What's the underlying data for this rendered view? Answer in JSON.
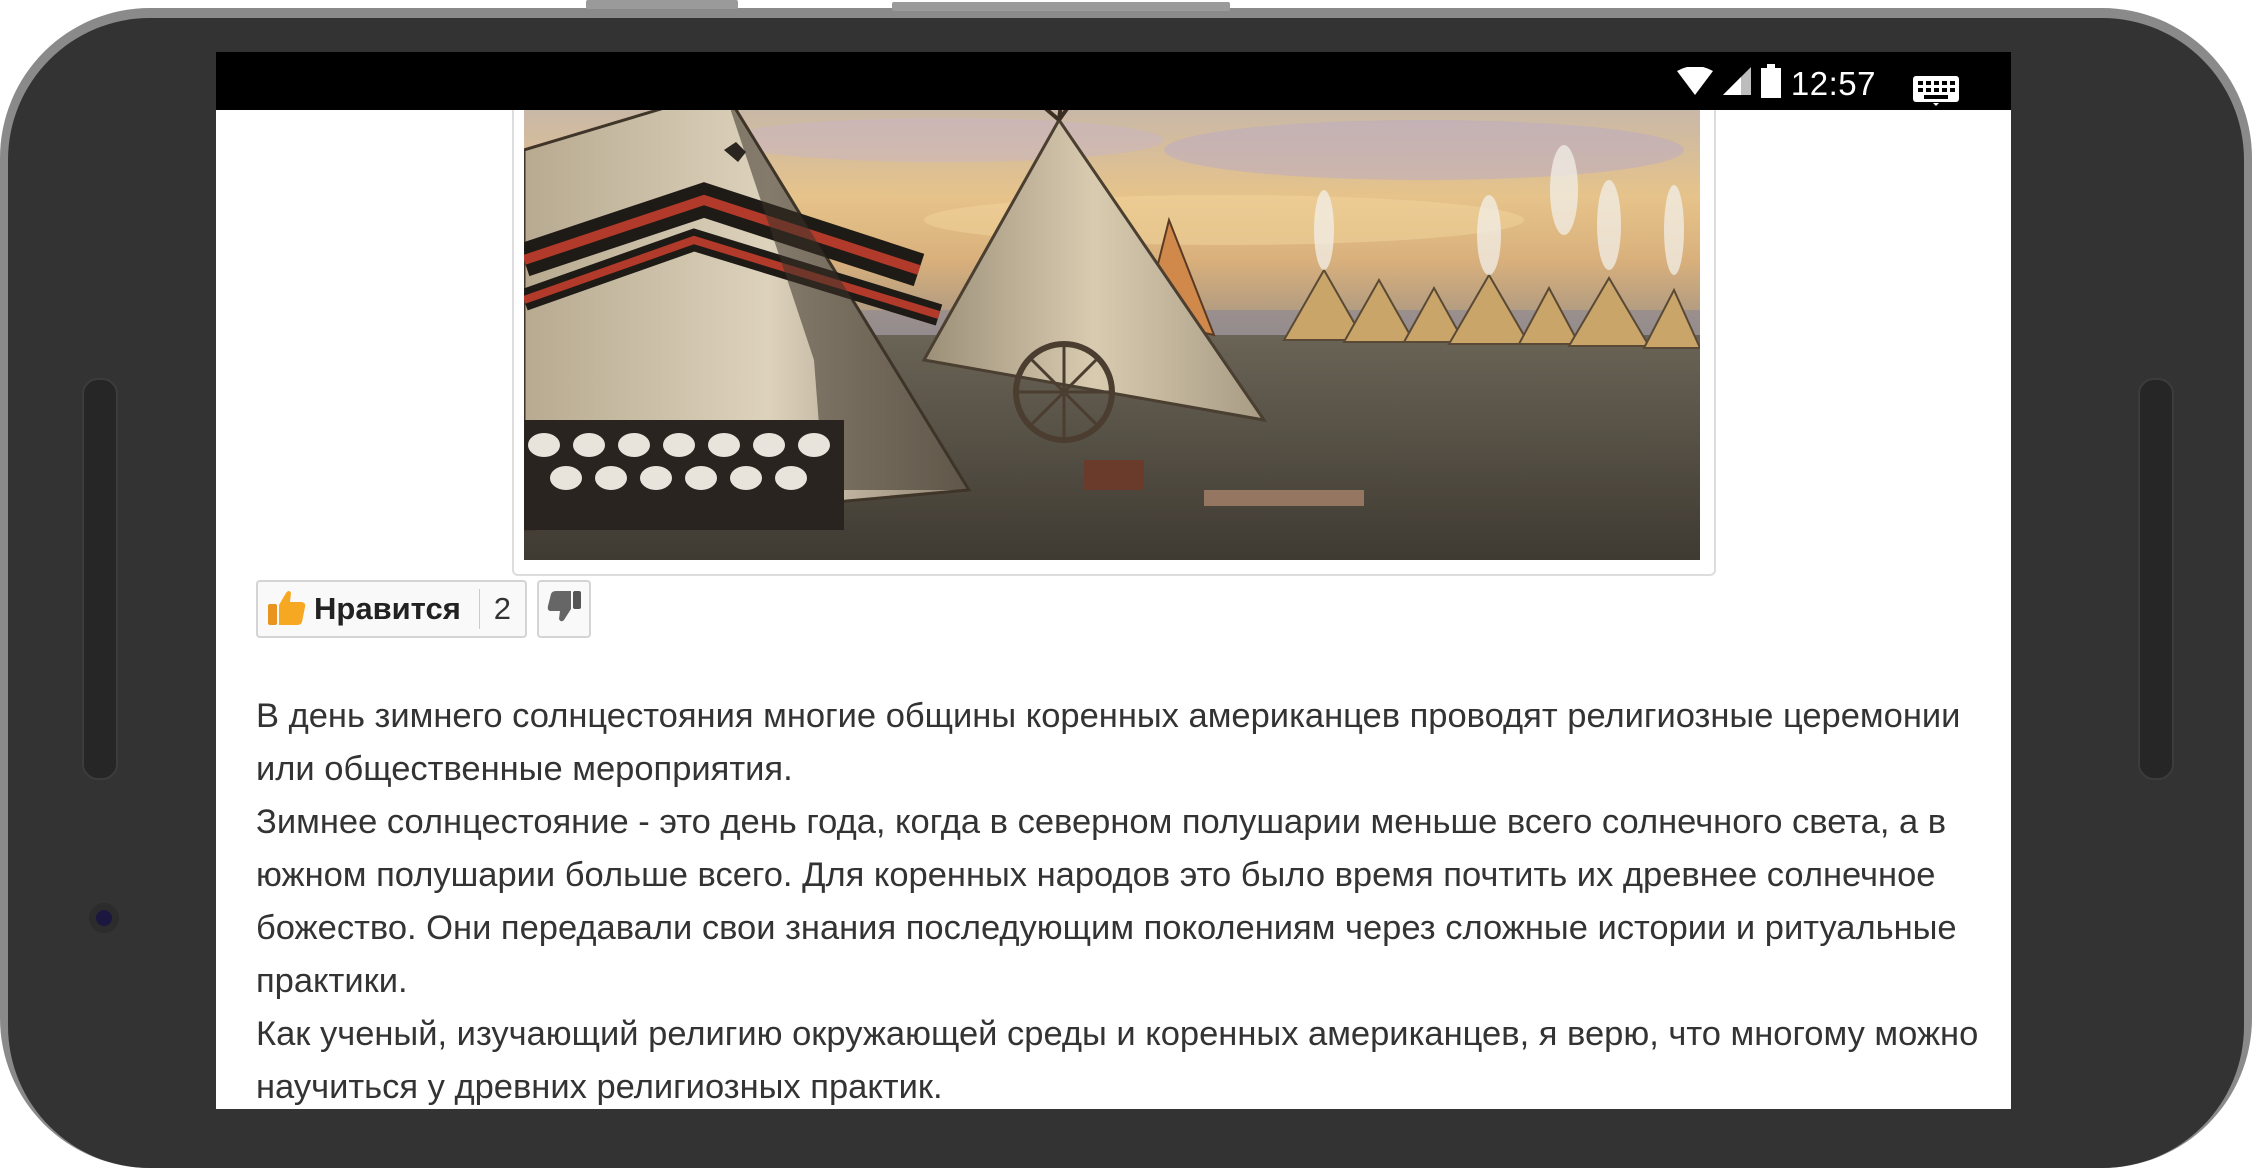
{
  "status_bar": {
    "time": "12:57",
    "icons": [
      "wifi-icon",
      "signal-icon",
      "battery-icon",
      "keyboard-icon"
    ]
  },
  "article": {
    "image": {
      "description": "tipi-camp-image"
    },
    "like_widget": {
      "like_label": "Нравится",
      "like_count": "2"
    },
    "paragraphs": [
      "В день зимнего солнцестояния многие общины коренных американцев проводят религиозные церемонии или общественные мероприятия.",
      "Зимнее солнцестояние - это день года, когда в северном полушарии меньше всего солнечного света, а в южном полушарии больше всего. Для коренных народов это было время почтить их древнее солнечное божество. Они передавали свои знания последующим поколениям через сложные истории и ритуальные практики.",
      "Как ученый, изучающий религию окружающей среды и коренных американцев, я верю, что многому можно научиться у древних религиозных практик."
    ]
  },
  "colors": {
    "frame": "#333333",
    "status_bar": "#000000",
    "text": "#333333",
    "like_icon": "#f5a623"
  }
}
